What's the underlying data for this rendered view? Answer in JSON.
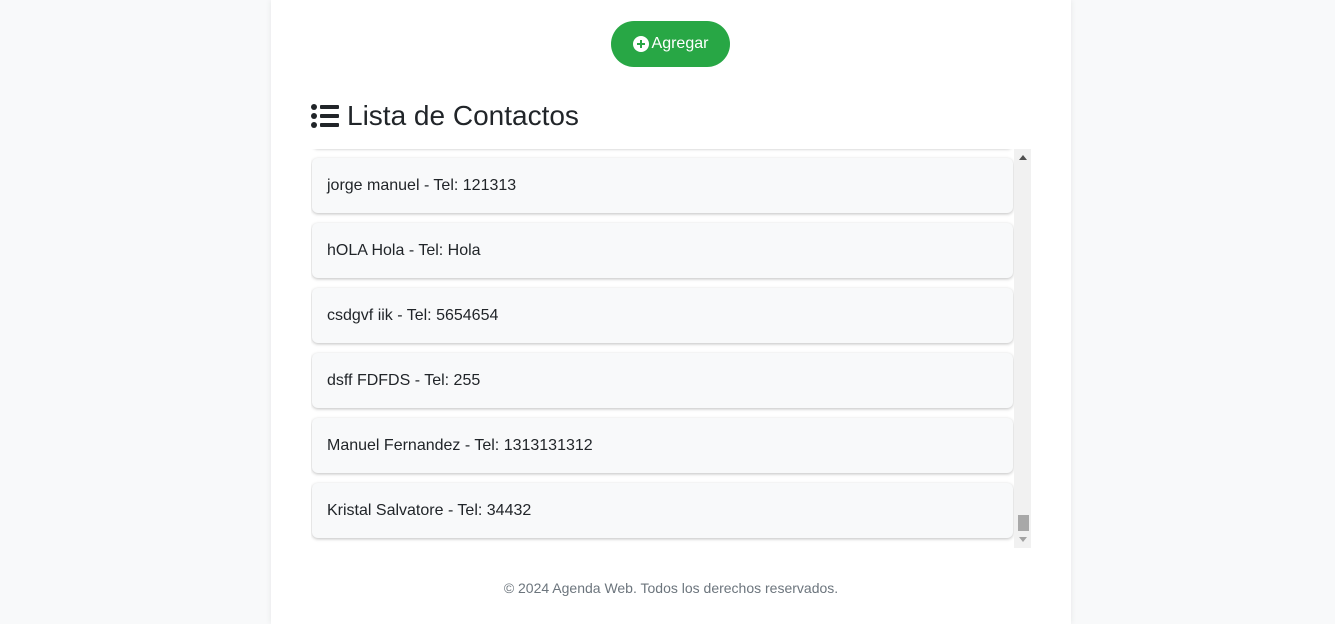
{
  "toolbar": {
    "add_label": "Agregar",
    "add_icon": "plus-circle-icon",
    "accent_color": "#28a745"
  },
  "contacts_section": {
    "title": "Lista de Contactos",
    "title_icon": "list-icon",
    "items": [
      {
        "text": ""
      },
      {
        "text": "jorge manuel - Tel: 121313"
      },
      {
        "text": "hOLA Hola - Tel: Hola"
      },
      {
        "text": "csdgvf iik - Tel: 5654654"
      },
      {
        "text": "dsff FDFDS - Tel: 255"
      },
      {
        "text": "Manuel Fernandez - Tel: 1313131312"
      },
      {
        "text": "Kristal Salvatore - Tel: 34432"
      }
    ]
  },
  "footer": {
    "text": "© 2024 Agenda Web. Todos los derechos reservados."
  }
}
